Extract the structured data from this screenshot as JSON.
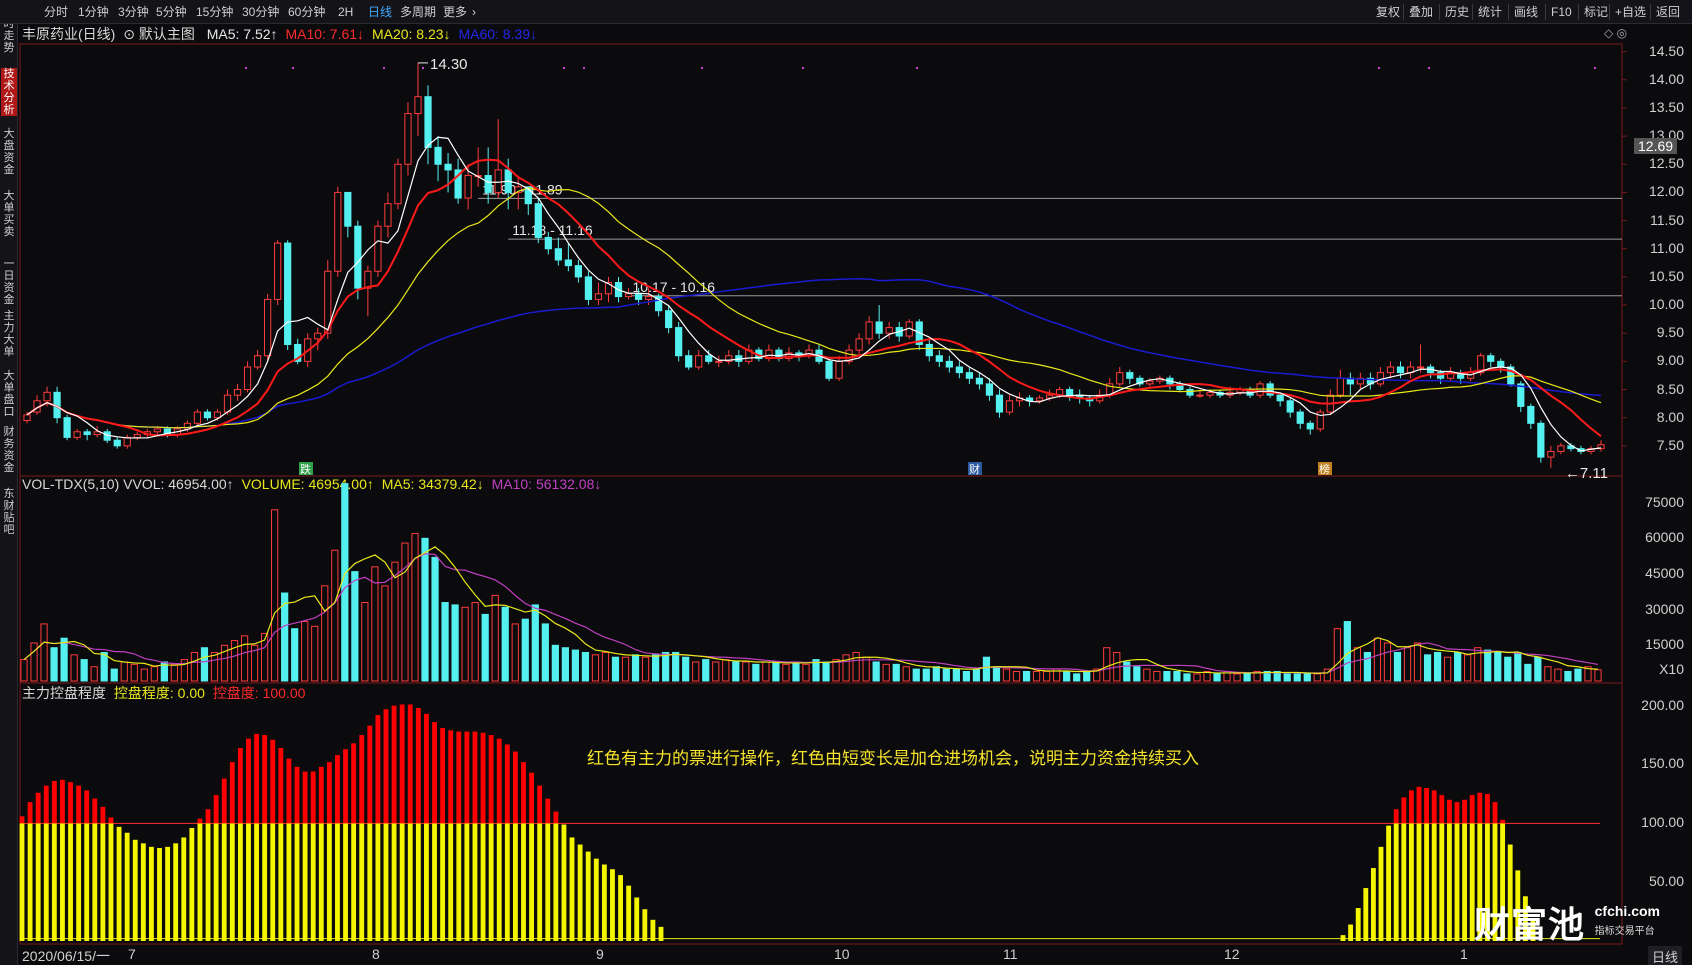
{
  "topbar": {
    "periods": [
      "分时",
      "1分钟",
      "3分钟",
      "5分钟",
      "15分钟",
      "30分钟",
      "60分钟",
      "2H",
      "日线",
      "多周期",
      "更多"
    ],
    "active_period": "日线",
    "tools": [
      "复权",
      "叠加",
      "历史",
      "统计",
      "画线",
      "F10",
      "标记",
      "+自选",
      "返回"
    ]
  },
  "sidebar": {
    "items": [
      "分时走势",
      "技术分析",
      "大盘资金",
      "大单买卖",
      "一日资金",
      "主力大单",
      "大单盘口",
      "财务资金",
      "东财贴吧"
    ],
    "active": "技术分析"
  },
  "price_panel": {
    "stock_name": "丰原药业(日线)",
    "chart_template": "默认主图",
    "ma5": "MA5: 7.52↑",
    "ma10": "MA10: 7.61↓",
    "ma20": "MA20: 8.23↓",
    "ma60": "MA60: 8.39↓",
    "current_price": "12.69",
    "high_label": "14.30",
    "low_label": "7.11",
    "level_labels": [
      "11.90 - 11.89",
      "11.18 - 11.16",
      "10.17 - 10.16"
    ],
    "markers": [
      "跌",
      "财",
      "榜"
    ]
  },
  "volume_panel": {
    "indicator": "VOL-TDX(5,10) VVOL: 46954.00↑",
    "volume": "VOLUME: 46954.00↑",
    "ma5": "MA5: 34379.42↓",
    "ma10": "MA10: 56132.08↓",
    "unit": "X10"
  },
  "control_panel": {
    "title": "主力控盘程度",
    "ctrl_degree": "控盘程度: 0.00",
    "ctrl": "控盘度: 100.00",
    "annotation": "红色有主力的票进行操作，红色由短变长是加仓进场机会，说明主力资金持续买入"
  },
  "x_axis": {
    "start_label": "2020/06/15/一",
    "months": [
      "7",
      "8",
      "9",
      "10",
      "11",
      "12",
      "1"
    ]
  },
  "bottom_button": "日线",
  "watermark": {
    "cn": "财富池",
    "en": "cfchi.com",
    "sub": "指标交易平台"
  },
  "colors": {
    "up": "#ff3b3b",
    "down": "#54f0f0",
    "ma5": "#ffffff",
    "ma10": "#ff1a1a",
    "ma20": "#e8e81a",
    "ma60": "#1a1ad0",
    "vol_ma5": "#e8e81a",
    "vol_ma10": "#c040c0",
    "ctrl_yellow": "#f5f500",
    "ctrl_red": "#ff0000"
  },
  "chart_data": [
    {
      "type": "candlestick",
      "title": "丰原药业(日线)",
      "y_ticks": [
        7.5,
        8.0,
        8.5,
        9.0,
        9.5,
        10.0,
        10.5,
        11.0,
        11.5,
        12.0,
        12.5,
        13.0,
        13.5,
        14.0,
        14.5
      ],
      "ylim": [
        7.0,
        14.6
      ],
      "candles": [
        [
          7.95,
          8.05,
          7.9,
          8.1
        ],
        [
          8.1,
          8.3,
          8.05,
          8.4
        ],
        [
          8.3,
          8.45,
          8.2,
          8.55
        ],
        [
          8.45,
          8.0,
          7.9,
          8.55
        ],
        [
          8.0,
          7.65,
          7.6,
          8.05
        ],
        [
          7.65,
          7.75,
          7.6,
          7.8
        ],
        [
          7.75,
          7.7,
          7.6,
          7.8
        ],
        [
          7.7,
          7.75,
          7.65,
          7.85
        ],
        [
          7.75,
          7.6,
          7.55,
          7.8
        ],
        [
          7.6,
          7.5,
          7.45,
          7.65
        ],
        [
          7.5,
          7.65,
          7.45,
          7.7
        ],
        [
          7.65,
          7.7,
          7.6,
          7.75
        ],
        [
          7.7,
          7.75,
          7.65,
          7.8
        ],
        [
          7.75,
          7.8,
          7.7,
          7.85
        ],
        [
          7.8,
          7.7,
          7.65,
          7.85
        ],
        [
          7.7,
          7.8,
          7.65,
          7.85
        ],
        [
          7.8,
          7.9,
          7.75,
          7.95
        ],
        [
          7.9,
          8.1,
          7.85,
          8.15
        ],
        [
          8.1,
          8.0,
          7.95,
          8.15
        ],
        [
          8.0,
          8.1,
          7.95,
          8.15
        ],
        [
          8.1,
          8.4,
          8.05,
          8.5
        ],
        [
          8.4,
          8.5,
          8.3,
          8.6
        ],
        [
          8.5,
          8.9,
          8.45,
          9.0
        ],
        [
          8.9,
          9.1,
          8.85,
          9.2
        ],
        [
          9.1,
          10.1,
          9.0,
          10.2
        ],
        [
          10.1,
          11.1,
          10.0,
          11.15
        ],
        [
          11.1,
          9.3,
          9.2,
          11.15
        ],
        [
          9.3,
          9.0,
          8.95,
          9.4
        ],
        [
          9.0,
          9.4,
          8.9,
          9.5
        ],
        [
          9.4,
          9.5,
          9.2,
          9.6
        ],
        [
          9.5,
          10.6,
          9.4,
          10.8
        ],
        [
          10.6,
          12.0,
          10.5,
          12.1
        ],
        [
          12.0,
          11.4,
          11.2,
          12.0
        ],
        [
          11.4,
          10.3,
          10.1,
          11.5
        ],
        [
          10.3,
          10.6,
          9.8,
          10.7
        ],
        [
          10.6,
          11.4,
          10.5,
          11.5
        ],
        [
          11.4,
          11.8,
          11.2,
          12.0
        ],
        [
          11.8,
          12.5,
          11.7,
          12.6
        ],
        [
          12.5,
          13.4,
          12.3,
          13.6
        ],
        [
          13.4,
          13.7,
          13.0,
          14.3
        ],
        [
          13.7,
          12.8,
          12.5,
          13.9
        ],
        [
          12.8,
          12.5,
          12.2,
          13.0
        ],
        [
          12.5,
          12.4,
          12.0,
          12.7
        ],
        [
          12.4,
          11.9,
          11.8,
          12.6
        ],
        [
          11.9,
          12.3,
          11.7,
          12.5
        ],
        [
          12.3,
          12.3,
          12.1,
          12.8
        ],
        [
          12.3,
          12.0,
          11.8,
          12.8
        ],
        [
          12.0,
          12.4,
          11.9,
          13.3
        ],
        [
          12.4,
          12.0,
          11.7,
          12.6
        ],
        [
          12.0,
          12.1,
          11.7,
          12.3
        ],
        [
          12.1,
          11.8,
          11.6,
          12.1
        ],
        [
          11.8,
          11.2,
          11.1,
          11.9
        ],
        [
          11.2,
          11.0,
          10.9,
          11.3
        ],
        [
          11.0,
          10.8,
          10.7,
          11.2
        ],
        [
          10.8,
          10.7,
          10.6,
          11.1
        ],
        [
          10.7,
          10.5,
          10.4,
          10.8
        ],
        [
          10.5,
          10.1,
          10.0,
          10.6
        ],
        [
          10.1,
          10.2,
          10.0,
          10.4
        ],
        [
          10.2,
          10.4,
          10.05,
          10.5
        ],
        [
          10.4,
          10.15,
          10.05,
          10.5
        ],
        [
          10.15,
          10.2,
          10.1,
          10.3
        ],
        [
          10.2,
          10.1,
          10.0,
          10.3
        ],
        [
          10.1,
          10.15,
          10.0,
          10.3
        ],
        [
          10.15,
          9.9,
          9.8,
          10.2
        ],
        [
          9.9,
          9.6,
          9.5,
          10.0
        ],
        [
          9.6,
          9.1,
          9.0,
          9.7
        ],
        [
          9.1,
          8.9,
          8.85,
          9.2
        ],
        [
          8.9,
          9.1,
          8.85,
          9.2
        ],
        [
          9.1,
          9.0,
          8.95,
          9.2
        ],
        [
          9.0,
          9.0,
          8.9,
          9.1
        ],
        [
          9.0,
          9.1,
          8.95,
          9.2
        ],
        [
          9.1,
          9.0,
          8.9,
          9.2
        ],
        [
          9.0,
          9.2,
          8.95,
          9.3
        ],
        [
          9.2,
          9.05,
          9.0,
          9.25
        ],
        [
          9.05,
          9.2,
          9.0,
          9.3
        ],
        [
          9.2,
          9.05,
          9.0,
          9.25
        ],
        [
          9.05,
          9.15,
          9.0,
          9.25
        ],
        [
          9.15,
          9.1,
          9.0,
          9.2
        ],
        [
          9.1,
          9.2,
          9.05,
          9.3
        ],
        [
          9.2,
          9.0,
          8.95,
          9.3
        ],
        [
          9.0,
          8.7,
          8.65,
          9.05
        ],
        [
          8.7,
          9.0,
          8.65,
          9.1
        ],
        [
          9.0,
          9.2,
          8.95,
          9.3
        ],
        [
          9.2,
          9.4,
          9.1,
          9.5
        ],
        [
          9.4,
          9.7,
          9.3,
          9.8
        ],
        [
          9.7,
          9.5,
          9.4,
          10.0
        ],
        [
          9.5,
          9.6,
          9.4,
          9.7
        ],
        [
          9.6,
          9.45,
          9.35,
          9.7
        ],
        [
          9.45,
          9.7,
          9.4,
          9.75
        ],
        [
          9.7,
          9.3,
          9.2,
          9.75
        ],
        [
          9.3,
          9.1,
          9.0,
          9.4
        ],
        [
          9.1,
          9.0,
          8.9,
          9.2
        ],
        [
          9.0,
          8.9,
          8.8,
          9.1
        ],
        [
          8.9,
          8.8,
          8.7,
          9.0
        ],
        [
          8.8,
          8.7,
          8.6,
          8.9
        ],
        [
          8.7,
          8.6,
          8.5,
          8.8
        ],
        [
          8.6,
          8.4,
          8.3,
          8.7
        ],
        [
          8.4,
          8.1,
          8.0,
          8.5
        ],
        [
          8.1,
          8.3,
          8.05,
          8.4
        ],
        [
          8.3,
          8.35,
          8.2,
          8.45
        ],
        [
          8.35,
          8.3,
          8.2,
          8.4
        ],
        [
          8.3,
          8.35,
          8.25,
          8.4
        ],
        [
          8.35,
          8.4,
          8.3,
          8.5
        ],
        [
          8.4,
          8.5,
          8.35,
          8.55
        ],
        [
          8.5,
          8.4,
          8.3,
          8.55
        ],
        [
          8.4,
          8.35,
          8.25,
          8.5
        ],
        [
          8.35,
          8.3,
          8.2,
          8.4
        ],
        [
          8.3,
          8.4,
          8.25,
          8.5
        ],
        [
          8.4,
          8.6,
          8.35,
          8.7
        ],
        [
          8.6,
          8.8,
          8.55,
          8.9
        ],
        [
          8.8,
          8.7,
          8.6,
          8.85
        ],
        [
          8.7,
          8.6,
          8.55,
          8.75
        ],
        [
          8.6,
          8.65,
          8.55,
          8.7
        ],
        [
          8.65,
          8.7,
          8.6,
          8.75
        ],
        [
          8.7,
          8.6,
          8.5,
          8.75
        ],
        [
          8.6,
          8.5,
          8.45,
          8.65
        ],
        [
          8.5,
          8.4,
          8.35,
          8.55
        ],
        [
          8.4,
          8.4,
          8.35,
          8.5
        ],
        [
          8.4,
          8.45,
          8.35,
          8.5
        ],
        [
          8.45,
          8.4,
          8.35,
          8.5
        ],
        [
          8.4,
          8.45,
          8.35,
          8.55
        ],
        [
          8.45,
          8.5,
          8.4,
          8.55
        ],
        [
          8.5,
          8.4,
          8.35,
          8.55
        ],
        [
          8.4,
          8.6,
          8.35,
          8.65
        ],
        [
          8.6,
          8.4,
          8.35,
          8.65
        ],
        [
          8.4,
          8.3,
          8.2,
          8.45
        ],
        [
          8.3,
          8.1,
          8.0,
          8.35
        ],
        [
          8.1,
          7.9,
          7.8,
          8.15
        ],
        [
          7.9,
          7.8,
          7.7,
          7.95
        ],
        [
          7.8,
          8.1,
          7.75,
          8.15
        ],
        [
          8.1,
          8.4,
          8.05,
          8.5
        ],
        [
          8.4,
          8.7,
          8.35,
          8.85
        ],
        [
          8.7,
          8.6,
          8.4,
          8.8
        ],
        [
          8.6,
          8.7,
          8.5,
          8.8
        ],
        [
          8.7,
          8.6,
          8.5,
          8.8
        ],
        [
          8.6,
          8.8,
          8.55,
          8.9
        ],
        [
          8.8,
          8.9,
          8.7,
          9.0
        ],
        [
          8.9,
          8.8,
          8.7,
          9.0
        ],
        [
          8.8,
          8.9,
          8.7,
          9.0
        ],
        [
          8.9,
          8.9,
          8.8,
          9.3
        ],
        [
          8.9,
          8.8,
          8.7,
          8.95
        ],
        [
          8.8,
          8.7,
          8.6,
          8.85
        ],
        [
          8.7,
          8.8,
          8.65,
          8.9
        ],
        [
          8.8,
          8.7,
          8.6,
          8.85
        ],
        [
          8.7,
          8.8,
          8.65,
          8.9
        ],
        [
          8.8,
          9.1,
          8.75,
          9.15
        ],
        [
          9.1,
          9.0,
          8.9,
          9.15
        ],
        [
          9.0,
          8.9,
          8.8,
          9.05
        ],
        [
          8.9,
          8.6,
          8.55,
          8.95
        ],
        [
          8.6,
          8.2,
          8.1,
          8.65
        ],
        [
          8.2,
          7.9,
          7.8,
          8.25
        ],
        [
          7.9,
          7.3,
          7.2,
          7.95
        ],
        [
          7.3,
          7.4,
          7.11,
          7.5
        ],
        [
          7.4,
          7.5,
          7.35,
          7.55
        ],
        [
          7.5,
          7.45,
          7.4,
          7.55
        ],
        [
          7.45,
          7.4,
          7.35,
          7.5
        ],
        [
          7.4,
          7.45,
          7.35,
          7.5
        ],
        [
          7.45,
          7.52,
          7.4,
          7.6
        ]
      ]
    },
    {
      "type": "bar",
      "title": "VOL-TDX(5,10)",
      "y_ticks": [
        15000,
        30000,
        45000,
        60000,
        75000
      ],
      "ylim": [
        0,
        82000
      ],
      "values": [
        9000,
        16000,
        24000,
        14000,
        18000,
        11000,
        9000,
        6000,
        12000,
        5000,
        8000,
        7000,
        5000,
        6000,
        8000,
        7000,
        9000,
        12000,
        14000,
        12000,
        15000,
        17000,
        19000,
        15000,
        20000,
        72000,
        37000,
        22000,
        25000,
        23000,
        40000,
        55000,
        83000,
        46000,
        33000,
        48000,
        40000,
        50000,
        58000,
        62000,
        60000,
        52000,
        33000,
        32000,
        31000,
        33000,
        28000,
        36000,
        31000,
        24000,
        26000,
        32000,
        24000,
        15000,
        14000,
        13000,
        12000,
        11000,
        12000,
        10000,
        10000,
        11000,
        10000,
        11000,
        12000,
        12000,
        10000,
        8000,
        9000,
        8000,
        9000,
        8000,
        8000,
        7000,
        8000,
        8000,
        7000,
        8000,
        7000,
        9000,
        8000,
        9000,
        11000,
        12000,
        10000,
        8000,
        7000,
        7000,
        6000,
        5000,
        5000,
        6000,
        5000,
        5000,
        4000,
        5000,
        10000,
        6000,
        5000,
        4000,
        4000,
        4000,
        4000,
        5000,
        4000,
        3000,
        4000,
        5000,
        14000,
        12000,
        8000,
        6000,
        5000,
        4000,
        4000,
        4000,
        3000,
        3000,
        4000,
        3000,
        4000,
        3000,
        3000,
        4000,
        4000,
        4000,
        3000,
        3000,
        3000,
        3000,
        5000,
        22000,
        25000,
        14000,
        12000,
        18000,
        16000,
        12000,
        14000,
        16000,
        11000,
        12000,
        10000,
        12000,
        11000,
        14000,
        13000,
        12000,
        10000,
        12000,
        7000,
        10000,
        6000,
        5000,
        4000,
        5000,
        6000,
        4700
      ],
      "ma5_label": "MA5",
      "ma10_label": "MA10"
    },
    {
      "type": "bar",
      "title": "主力控盘程度",
      "y_ticks": [
        50,
        100,
        150,
        200
      ],
      "ylim": [
        0,
        215
      ],
      "threshold": 100,
      "values": [
        106,
        118,
        126,
        132,
        136,
        137,
        135,
        132,
        128,
        121,
        114,
        105,
        97,
        92,
        86,
        83,
        80,
        79,
        80,
        83,
        88,
        96,
        104,
        112,
        124,
        138,
        152,
        164,
        172,
        176,
        175,
        171,
        164,
        155,
        148,
        144,
        144,
        148,
        152,
        158,
        163,
        168,
        175,
        183,
        192,
        197,
        200,
        201,
        201,
        198,
        193,
        186,
        181,
        179,
        178,
        178,
        178,
        177,
        175,
        172,
        167,
        161,
        152,
        143,
        132,
        121,
        110,
        99,
        88,
        82,
        76,
        70,
        65,
        61,
        56,
        47,
        37,
        27,
        18,
        12
      ]
    }
  ]
}
